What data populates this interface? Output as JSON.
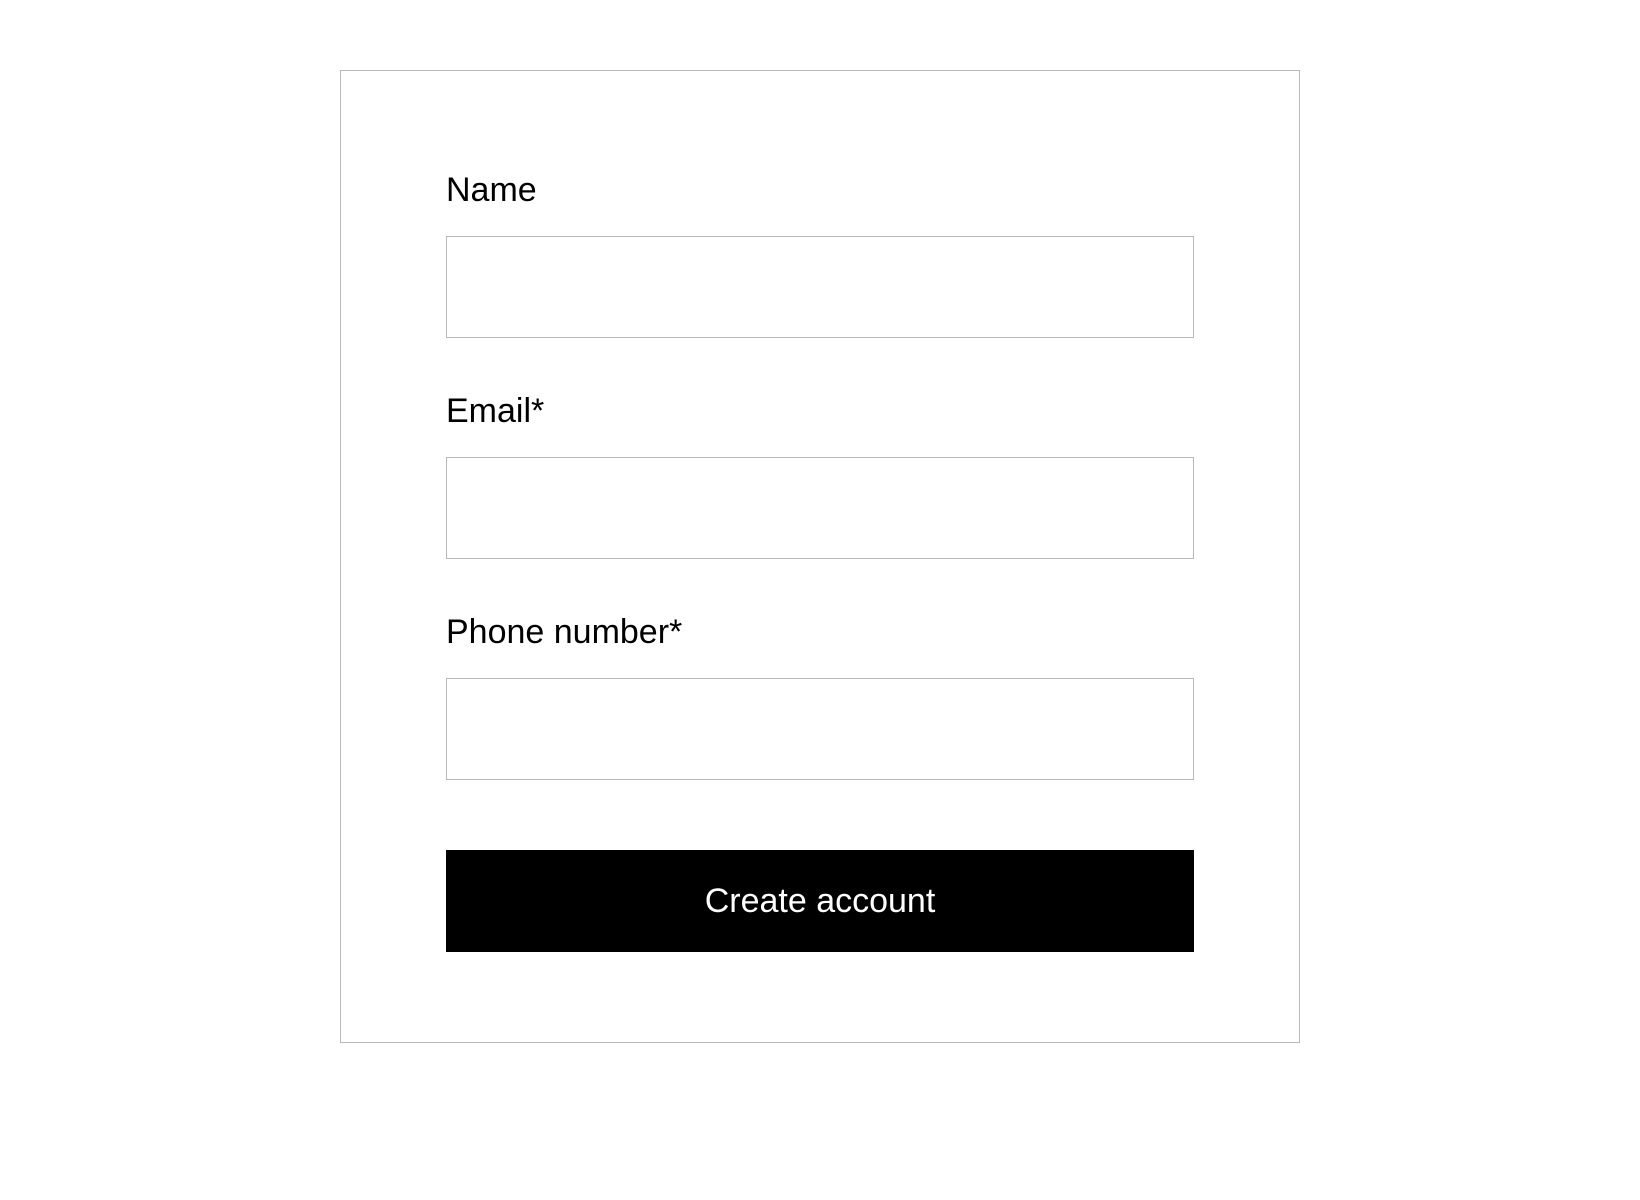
{
  "form": {
    "fields": {
      "name": {
        "label": "Name",
        "value": ""
      },
      "email": {
        "label": "Email*",
        "value": ""
      },
      "phone": {
        "label": "Phone number*",
        "value": ""
      }
    },
    "submit_label": "Create account"
  }
}
